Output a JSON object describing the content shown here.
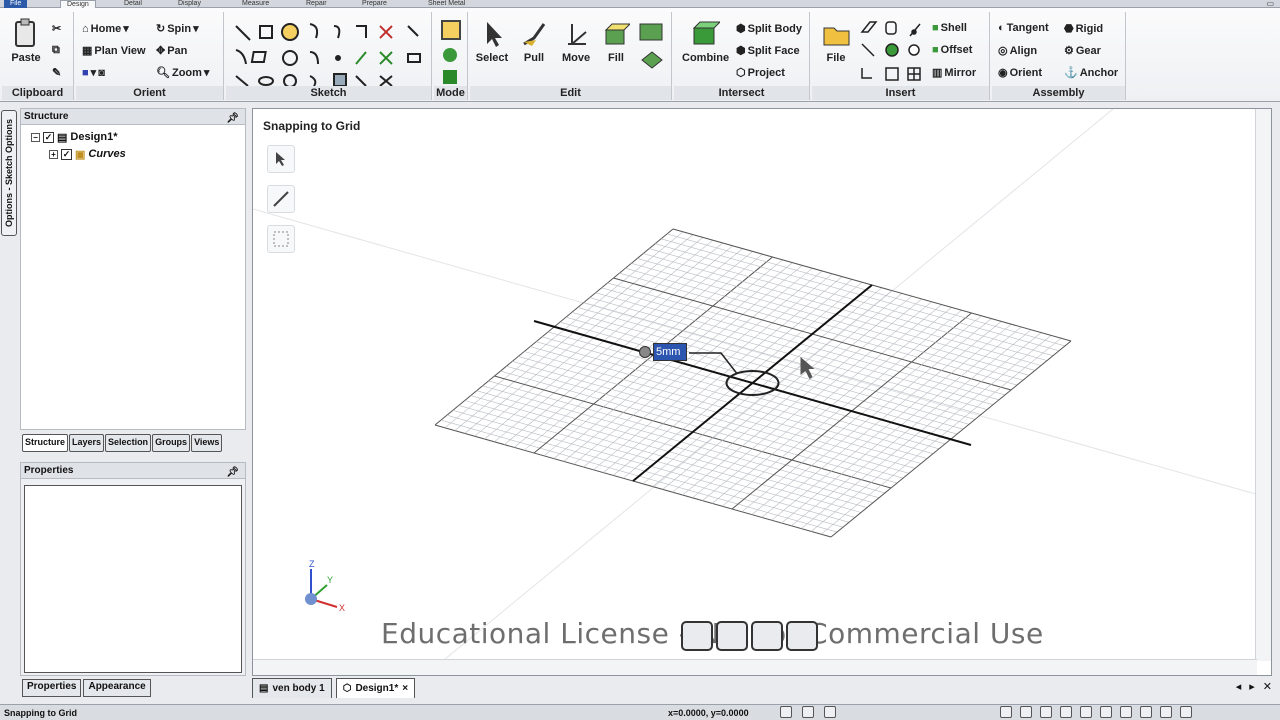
{
  "ribbon": {
    "tabs": [
      "File",
      "Design",
      "Detail",
      "Display",
      "Measure",
      "Repair",
      "Prepare",
      "Sheet Metal"
    ],
    "active_tab": "Design",
    "groups": {
      "clipboard": {
        "label": "Clipboard",
        "paste": "Paste"
      },
      "orient": {
        "label": "Orient",
        "home": "Home",
        "plan_view": "Plan View",
        "spin": "Spin",
        "pan": "Pan",
        "zoom": "Zoom"
      },
      "sketch": {
        "label": "Sketch"
      },
      "mode": {
        "label": "Mode"
      },
      "edit": {
        "label": "Edit",
        "select": "Select",
        "pull": "Pull",
        "move": "Move",
        "fill": "Fill"
      },
      "intersect": {
        "label": "Intersect",
        "combine": "Combine",
        "split_body": "Split Body",
        "split_face": "Split Face",
        "project": "Project"
      },
      "insert": {
        "label": "Insert",
        "file": "File",
        "shell": "Shell",
        "offset": "Offset",
        "mirror": "Mirror"
      },
      "assembly": {
        "label": "Assembly",
        "tangent": "Tangent",
        "align": "Align",
        "orient": "Orient",
        "rigid": "Rigid",
        "gear": "Gear",
        "anchor": "Anchor"
      }
    }
  },
  "side_tab": "Options - Sketch Options",
  "structure": {
    "title": "Structure",
    "root": "Design1*",
    "child": "Curves"
  },
  "panel_tabs": [
    "Structure",
    "Layers",
    "Selection",
    "Groups",
    "Views"
  ],
  "properties": {
    "title": "Properties"
  },
  "bottom_tabs": [
    "Properties",
    "Appearance"
  ],
  "viewport": {
    "hint": "Snapping to Grid",
    "dimension_value": "5mm",
    "watermark": "Educational License - Not for Commercial Use",
    "axes": {
      "z": "Z",
      "y": "Y",
      "x": "X"
    }
  },
  "doc_tabs": [
    {
      "label": "ven body 1"
    },
    {
      "label": "Design1*"
    }
  ],
  "status": {
    "text": "Snapping to Grid",
    "coords": "x=0.0000, y=0.0000"
  },
  "colors": {
    "accent": "#2d5aa8",
    "grid_major": "#222222",
    "axis_x": "#d03030",
    "axis_y": "#30a030",
    "axis_z": "#3050d0"
  }
}
